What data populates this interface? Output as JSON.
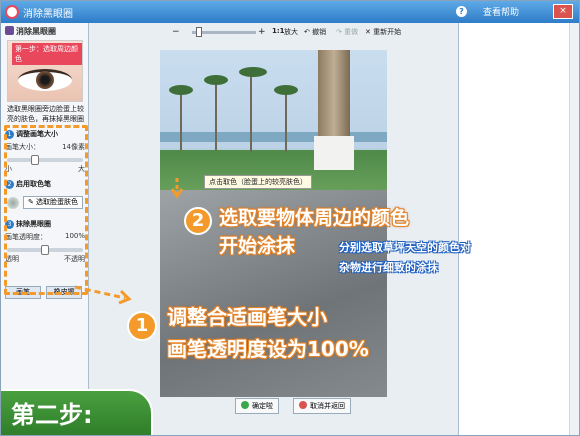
{
  "window": {
    "title": "消除黑眼圈",
    "help_label": "查看帮助",
    "close_label": "×"
  },
  "left_panel": {
    "header": "消除黑眼圈",
    "step_tag": "第一步：选取周边颜色",
    "description": "选取黑眼圈旁边脸蛋上较亮的肤色，再抹掉黑眼圈",
    "section1": {
      "num": "1",
      "title": "调整画笔大小",
      "size_label": "画笔大小：",
      "size_value": "14像素",
      "min_label": "小",
      "max_label": "大"
    },
    "section2": {
      "num": "2",
      "title": "启用取色笔",
      "pick_button": "选取脸蛋肤色"
    },
    "section3": {
      "num": "3",
      "title": "抹除黑眼圈",
      "opacity_label": "画笔透明度：",
      "opacity_value": "100%",
      "min_label": "透明",
      "max_label": "不透明"
    },
    "tabs": [
      "画笔",
      "橡皮擦"
    ]
  },
  "toolbar": {
    "zoom_out": "−",
    "zoom_in": "+",
    "ratio": "1:1",
    "zoom_in_label": "放大",
    "undo": "撤销",
    "redo": "重做",
    "reset": "重新开始"
  },
  "canvas": {
    "tooltip": "点击取色（脸蛋上的较亮肤色）"
  },
  "annotations": {
    "num2": "2",
    "line2a": "选取要物体周边的颜色",
    "line2b": "开始涂抹",
    "blue_a": "分别选取草坪天空的颜色对",
    "blue_b": "杂物进行细致的涂抹",
    "num1": "1",
    "line1a": "调整合适画笔大小",
    "line1b": "画笔透明度设为100%",
    "step": "第二步:"
  },
  "actions": {
    "ok": "确定啦",
    "cancel": "取消并返回"
  },
  "colors": {
    "accent": "#f39a2b",
    "step_green": "#3a9a35",
    "title_blue": "#2f7cc8"
  }
}
